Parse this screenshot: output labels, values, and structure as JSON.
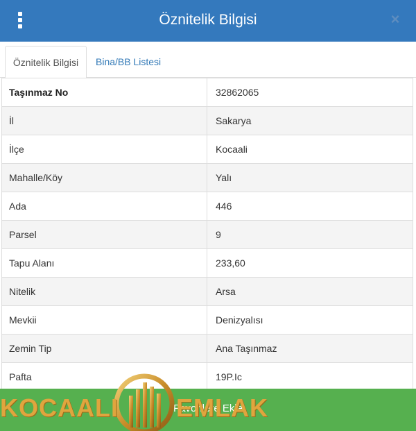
{
  "header": {
    "title": "Öznitelik Bilgisi",
    "close_label": "×",
    "menu_icon": "vertical-ellipsis-icon",
    "background": "#3479bd"
  },
  "tabs": [
    {
      "label": "Öznitelik Bilgisi",
      "active": true
    },
    {
      "label": "Bina/BB Listesi",
      "active": false
    }
  ],
  "rows": [
    {
      "key": "Taşınmaz No",
      "value": "32862065"
    },
    {
      "key": "İl",
      "value": "Sakarya"
    },
    {
      "key": "İlçe",
      "value": "Kocaali"
    },
    {
      "key": "Mahalle/Köy",
      "value": "Yalı"
    },
    {
      "key": "Ada",
      "value": "446"
    },
    {
      "key": "Parsel",
      "value": "9"
    },
    {
      "key": "Tapu Alanı",
      "value": "233,60"
    },
    {
      "key": "Nitelik",
      "value": "Arsa"
    },
    {
      "key": "Mevkii",
      "value": "Denizyalısı"
    },
    {
      "key": "Zemin Tip",
      "value": "Ana Taşınmaz"
    },
    {
      "key": "Pafta",
      "value": "19P.Ic"
    }
  ],
  "footer": {
    "button_label": "Favorilere Ekle",
    "background": "#56b04f"
  },
  "watermark": {
    "left_text": "KOCAALI",
    "right_text": "EMLAK",
    "color": "#e0a53e"
  }
}
